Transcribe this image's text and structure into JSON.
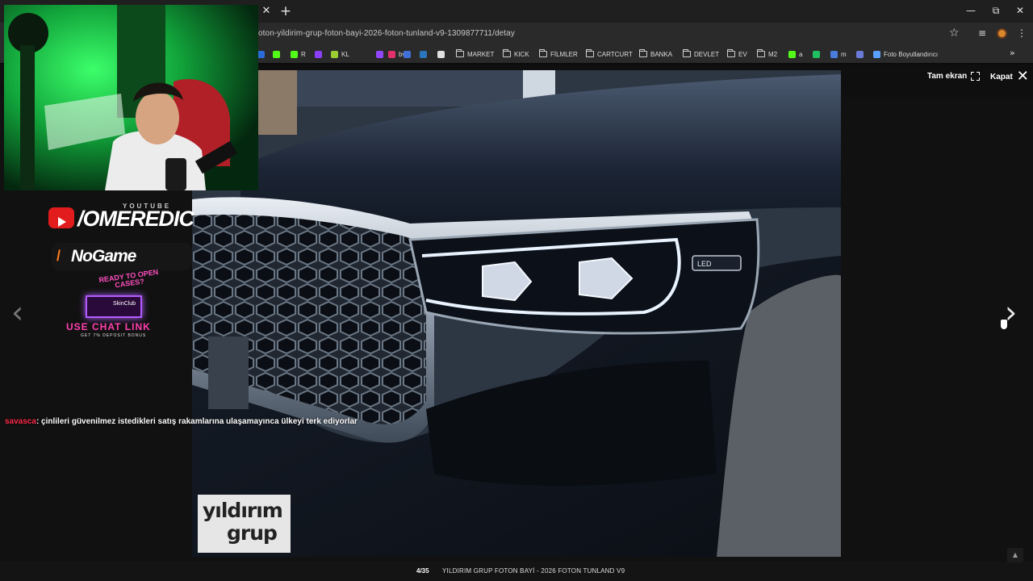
{
  "browser": {
    "url": "oton-yildirim-grup-foton-bayi-2026-foton-tunland-v9-1309877711/detay",
    "window_controls": {
      "minimize": "—",
      "restore": "⧉",
      "close": "✕"
    },
    "tab_close": "✕",
    "new_tab": "+",
    "bookmarks": [
      {
        "label": "",
        "color": "#2a6bd8"
      },
      {
        "label": "",
        "color": "#53fc18"
      },
      {
        "label": "R",
        "color": "#53fc18"
      },
      {
        "label": "",
        "color": "#8a3ffc"
      },
      {
        "label": "KL",
        "color": "#9acd32"
      },
      {
        "label": "",
        "color": "#9146ff"
      },
      {
        "label": "bv",
        "color": "#e1306c"
      },
      {
        "label": "",
        "color": "#3f6fd8"
      },
      {
        "label": "",
        "color": "#2a75bb"
      },
      {
        "label": "",
        "color": "#e0e0e0"
      },
      {
        "label": "MARKET",
        "folder": true
      },
      {
        "label": "KICK",
        "folder": true
      },
      {
        "label": "FİLMLER",
        "folder": true
      },
      {
        "label": "CARTCURT",
        "folder": true
      },
      {
        "label": "BANKA",
        "folder": true
      },
      {
        "label": "DEVLET",
        "folder": true
      },
      {
        "label": "EV",
        "folder": true
      },
      {
        "label": "M2",
        "folder": true
      },
      {
        "label": "a",
        "color": "#53fc18"
      },
      {
        "label": "",
        "color": "#20c060"
      },
      {
        "label": "m",
        "color": "#4a7ddb"
      },
      {
        "label": "",
        "color": "#6b7bd8"
      },
      {
        "label": "Foto Boyutlandırıcı",
        "color": "#5aa0ff"
      }
    ],
    "bookmarks_more": "»"
  },
  "lightbox": {
    "fullscreen_label": "Tam ekran",
    "close_label": "Kapat",
    "counter": "4/35",
    "caption": "YILDIRIM GRUP FOTON BAYİ - 2026 FOTON TUNLAND V9",
    "watermark_line1": "yıldırım",
    "watermark_line2": "grup",
    "prev_arrow": "‹",
    "next_arrow": "›",
    "scroll_top": "▲"
  },
  "stream_overlay": {
    "youtube_label": "YOUTUBE",
    "channel_name": "/OMEREDIC",
    "sponsor1": "NoGame",
    "sponsor2_headline": "READY TO OPEN CASES?",
    "sponsor2_brand": "SkinClub",
    "sponsor2_cta": "USE CHAT LINK",
    "sponsor2_sub": "GET 7% DEPOSIT BONUS",
    "chat_user": "savasca",
    "chat_message": ": çinlileri güvenilmez istedikleri satış rakamlarına ulaşamayınca ülkeyi terk ediyorlar"
  }
}
